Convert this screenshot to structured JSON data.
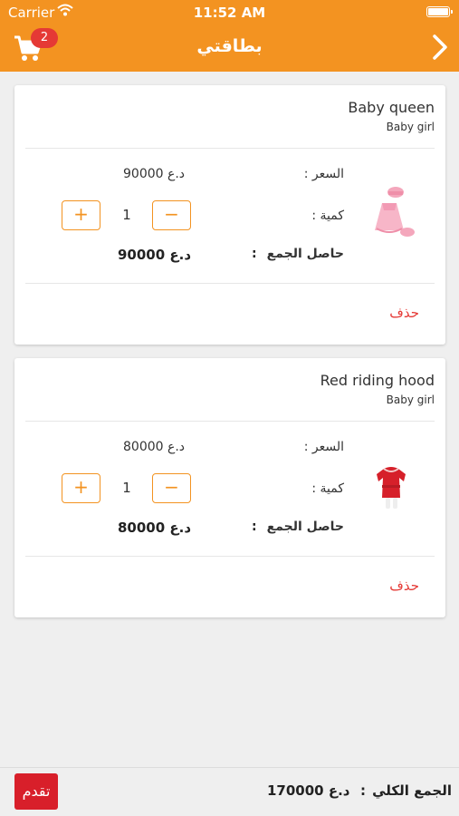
{
  "status_bar": {
    "carrier": "Carrier",
    "time": "11:52 AM"
  },
  "nav": {
    "title": "بطاقتي",
    "cart_count": "2"
  },
  "labels": {
    "price": "السعر :",
    "quantity": "كمية :",
    "total": "حاصل الجمع",
    "colon": ":",
    "delete": "حذف"
  },
  "items": [
    {
      "name": "Baby queen",
      "category": "Baby girl",
      "price": "90000 د.ع",
      "quantity": "1",
      "total": "90000 د.ع",
      "image_icon": "pink-baby-dress-image"
    },
    {
      "name": "Red riding hood",
      "category": "Baby girl",
      "price": "80000 د.ع",
      "quantity": "1",
      "total": "80000 د.ع",
      "image_icon": "red-baby-dress-image"
    }
  ],
  "footer": {
    "grand_total_label": "الجمع الكلي",
    "colon": ":",
    "grand_total_value": "170000 د.ع",
    "checkout_label": "تقدم"
  },
  "colors": {
    "header": "#f39321",
    "accent": "#f39321",
    "danger": "#e53935",
    "checkout": "#d81f2a"
  },
  "icons": {
    "cart": "cart-icon",
    "forward": "chevron-right-icon",
    "plus": "plus-icon",
    "minus": "minus-icon",
    "wifi": "wifi-icon",
    "battery": "battery-icon"
  }
}
